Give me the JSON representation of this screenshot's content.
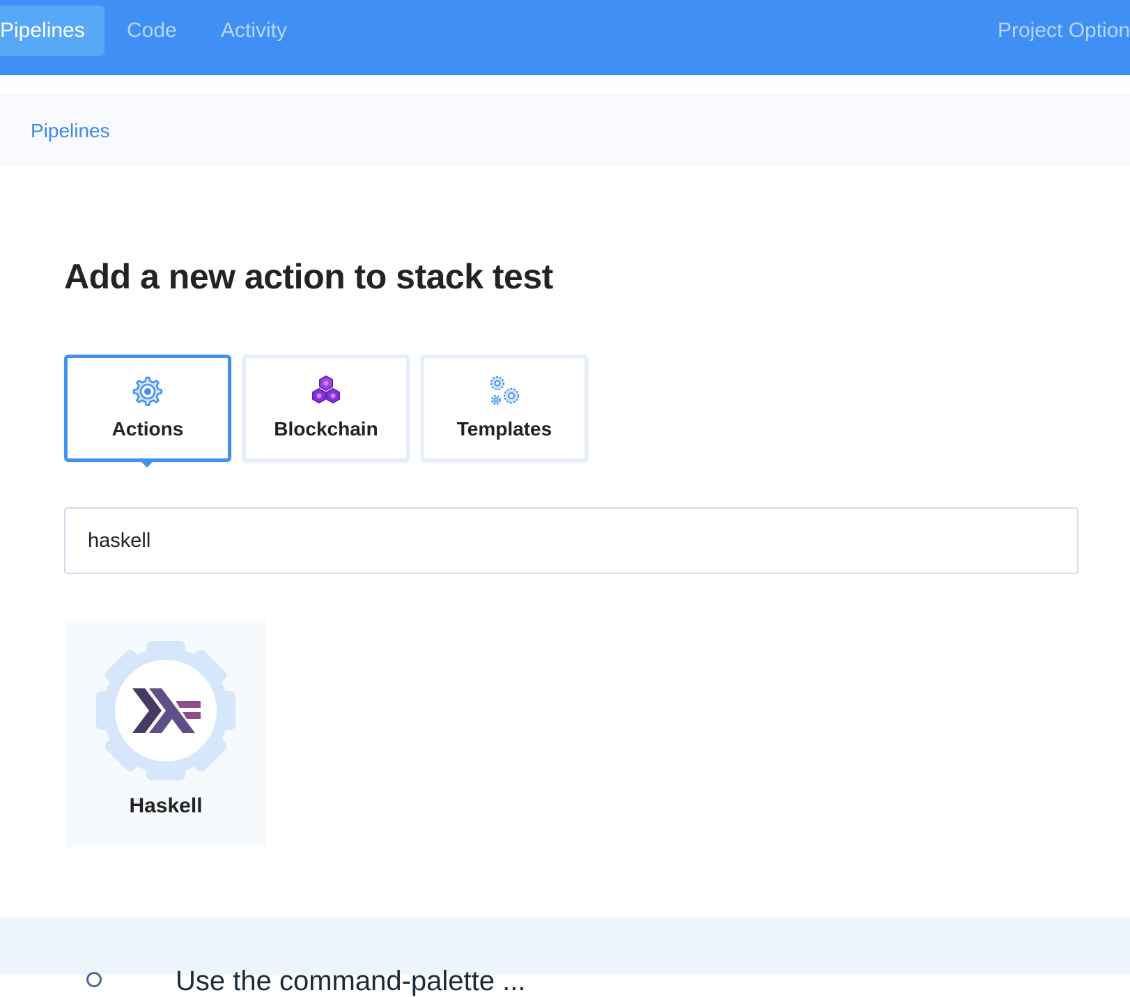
{
  "nav": {
    "tabs": [
      {
        "label": "Pipelines",
        "active": true
      },
      {
        "label": "Code",
        "active": false
      },
      {
        "label": "Activity",
        "active": false
      }
    ],
    "right_label": "Project Option",
    "bar_color": "#3f8ff5"
  },
  "breadcrumb": {
    "label": "Pipelines"
  },
  "page": {
    "title": "Add a new action to stack test"
  },
  "categories": [
    {
      "label": "Actions",
      "icon": "gear-icon",
      "selected": true
    },
    {
      "label": "Blockchain",
      "icon": "hexagons-icon",
      "selected": false
    },
    {
      "label": "Templates",
      "icon": "gears-icon",
      "selected": false
    }
  ],
  "search": {
    "value": "haskell"
  },
  "results": [
    {
      "label": "Haskell",
      "icon": "haskell-logo-icon"
    }
  ],
  "footer": {
    "text": "Use the command-palette ..."
  }
}
